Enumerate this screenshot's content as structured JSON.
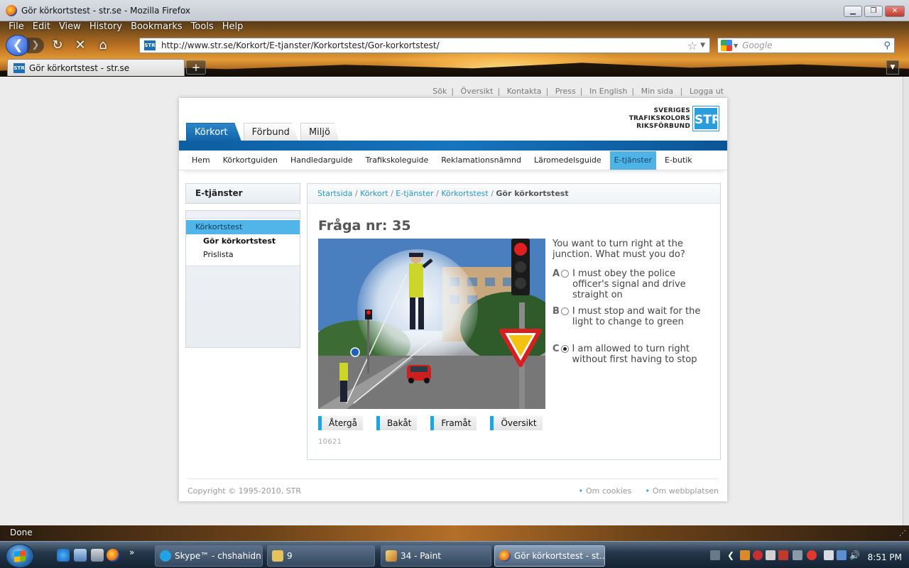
{
  "window": {
    "title": "Gör körkortstest - str.se - Mozilla Firefox"
  },
  "menu": [
    "File",
    "Edit",
    "View",
    "History",
    "Bookmarks",
    "Tools",
    "Help"
  ],
  "address": {
    "url": "http://www.str.se/Korkort/E-tjanster/Korkortstest/Gor-korkortstest/",
    "favicon": "STR"
  },
  "search": {
    "placeholder": "Google"
  },
  "tab": {
    "title": "Gör körkortstest - str.se",
    "new_tab_label": "+"
  },
  "toplinks": [
    "Sök",
    "Översikt",
    "Kontakta",
    "Press",
    "In English",
    "Min sida",
    "Logga ut"
  ],
  "logo": {
    "line1": "SVERIGES",
    "line2": "TRAFIKSKOLORS",
    "line3": "RIKSFÖRBUND",
    "mark": "STR"
  },
  "main_tabs": [
    "Körkort",
    "Förbund",
    "Miljö"
  ],
  "subnav": [
    "Hem",
    "Körkortguiden",
    "Handledarguide",
    "Trafikskoleguide",
    "Reklamationsnämnd",
    "Läromedelsguide",
    "E-tjänster",
    "E-butik"
  ],
  "sidebar": {
    "heading": "E-tjänster",
    "selected": "Körkortstest",
    "items": [
      "Gör körkortstest",
      "Prislista"
    ]
  },
  "breadcrumb": {
    "items": [
      "Startsida",
      "Körkort",
      "E-tjänster",
      "Körkortstest"
    ],
    "current": "Gör körkortstest",
    "separator": "/"
  },
  "question": {
    "title": "Fråga nr: 35",
    "text": "You want to turn right at the junction. What must you do?",
    "options": [
      {
        "letter": "A",
        "text": "I must obey the police officer's signal and drive straight on",
        "checked": false
      },
      {
        "letter": "B",
        "text": "I must stop and wait for the light to change to green",
        "checked": false
      },
      {
        "letter": "C",
        "text": "I am allowed to turn right without first having to stop",
        "checked": true
      }
    ],
    "id": "10621"
  },
  "buttons": [
    "Återgå",
    "Bakåt",
    "Framåt",
    "Översikt"
  ],
  "footer": {
    "copyright": "Copyright © 1995-2010, STR",
    "links": [
      "Om cookies",
      "Om webbplatsen"
    ]
  },
  "status": {
    "text": "Done"
  },
  "taskbar": {
    "items": [
      "Skype™ - chshahidn...",
      "9",
      "34 - Paint",
      "Gör körkortstest - st..."
    ],
    "clock": "8:51 PM",
    "chevron": "»"
  },
  "colors": {
    "brand_blue": "#1264a8",
    "accent_cyan": "#4fb3e6",
    "link": "#2a96c6"
  }
}
